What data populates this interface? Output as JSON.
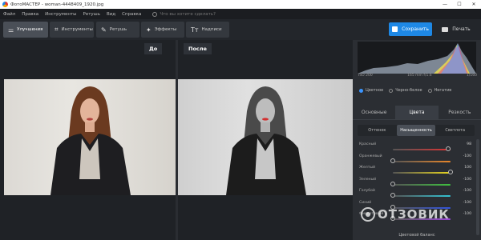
{
  "window": {
    "title": "ФотоМАСТЕР - woman-4448409_1920.jpg",
    "controls": [
      "—",
      "☐",
      "✕"
    ]
  },
  "menu": {
    "items": [
      "Файл",
      "Правка",
      "Инструменты",
      "Ретушь",
      "Вид",
      "Справка"
    ],
    "search_placeholder": "Что вы хотите сделать?"
  },
  "toolbar": {
    "tabs": [
      {
        "label": "Улучшения",
        "icon": "sliders-icon",
        "glyph": "⚌"
      },
      {
        "label": "Инструменты",
        "icon": "crop-icon",
        "glyph": "⌗"
      },
      {
        "label": "Ретушь",
        "icon": "brush-icon",
        "glyph": "✎"
      },
      {
        "label": "Эффекты",
        "icon": "wand-icon",
        "glyph": "✦"
      },
      {
        "label": "Надписи",
        "icon": "text-icon",
        "glyph": "Tт"
      }
    ],
    "save_label": "Сохранить",
    "print_label": "Печать"
  },
  "compare": {
    "before": "До",
    "after": "После"
  },
  "histogram": {
    "iso": "ISO 200",
    "lens": "165 mm f/1.6",
    "shutter": "1/160"
  },
  "modes": [
    "Цветное",
    "Черно-белое",
    "Негатив"
  ],
  "subtabs": [
    "Основные",
    "Цвета",
    "Резкость"
  ],
  "segments": [
    "Оттенок",
    "Насыщенность",
    "Светлота"
  ],
  "sliders": [
    {
      "label": "Красный",
      "value": "98",
      "level": 0.96,
      "track": "linear-gradient(90deg,#555,#d33)"
    },
    {
      "label": "Оранжевый",
      "value": "-100",
      "level": 0.0,
      "track": "linear-gradient(90deg,#555,#e8862a)"
    },
    {
      "label": "Желтый",
      "value": "100",
      "level": 1.0,
      "track": "linear-gradient(90deg,#555,#e7d51e)"
    },
    {
      "label": "Зеленый",
      "value": "-100",
      "level": 0.0,
      "track": "linear-gradient(90deg,#555,#3fbf3f)"
    },
    {
      "label": "Голубой",
      "value": "-100",
      "level": 0.0,
      "track": "linear-gradient(90deg,#555,#33c3d3)"
    },
    {
      "label": "Синий",
      "value": "-100",
      "level": 0.0,
      "track": "linear-gradient(90deg,#555,#3355dd)"
    },
    {
      "label": "Фиолетовый",
      "value": "-100",
      "level": 0.0,
      "track": "linear-gradient(90deg,#555,#9a47d8)"
    }
  ],
  "panel_footer": "Цветовой баланс",
  "watermark": "ОТЗОВИК",
  "colors": {
    "accent": "#1e88e5",
    "radio_on": "#3b95ff"
  }
}
